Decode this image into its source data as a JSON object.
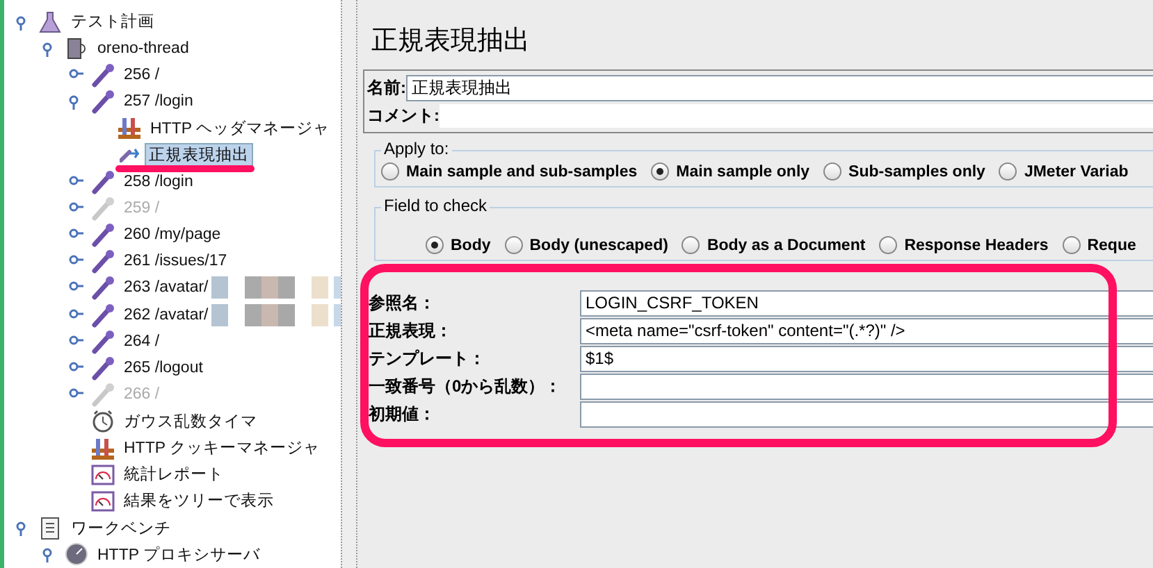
{
  "tree": [
    {
      "label": "テスト計画",
      "kind": "plan",
      "expanded": true,
      "children": [
        {
          "label": "oreno-thread",
          "kind": "thread",
          "expanded": true,
          "children": [
            {
              "label": "256 /",
              "kind": "sampler",
              "expanded": false,
              "disabled": false
            },
            {
              "label": "257 /login",
              "kind": "sampler",
              "expanded": true,
              "disabled": false,
              "children": [
                {
                  "label": "HTTP ヘッダマネージャ",
                  "kind": "manager",
                  "selected": false
                },
                {
                  "label": "正規表現抽出",
                  "kind": "extractor",
                  "selected": true
                }
              ]
            },
            {
              "label": "258 /login",
              "kind": "sampler",
              "expanded": false,
              "disabled": false
            },
            {
              "label": "259 /",
              "kind": "sampler",
              "expanded": false,
              "disabled": true
            },
            {
              "label": "260 /my/page",
              "kind": "sampler",
              "expanded": false,
              "disabled": false
            },
            {
              "label": "261 /issues/17",
              "kind": "sampler",
              "expanded": false,
              "disabled": false
            },
            {
              "label": "263 /avatar/",
              "kind": "sampler",
              "expanded": false,
              "disabled": false,
              "redacted": true
            },
            {
              "label": "262 /avatar/",
              "kind": "sampler",
              "expanded": false,
              "disabled": false,
              "redacted": true
            },
            {
              "label": "264 /",
              "kind": "sampler",
              "expanded": false,
              "disabled": false
            },
            {
              "label": "265 /logout",
              "kind": "sampler",
              "expanded": false,
              "disabled": false
            },
            {
              "label": "266 /",
              "kind": "sampler",
              "expanded": false,
              "disabled": true
            },
            {
              "label": "ガウス乱数タイマ",
              "kind": "timer"
            },
            {
              "label": "HTTP クッキーマネージャ",
              "kind": "manager"
            },
            {
              "label": "統計レポート",
              "kind": "report"
            },
            {
              "label": "結果をツリーで表示",
              "kind": "report"
            }
          ]
        }
      ]
    },
    {
      "label": "ワークベンチ",
      "kind": "workbench",
      "expanded": true,
      "children": [
        {
          "label": "HTTP プロキシサーバ",
          "kind": "proxy",
          "expanded": true
        }
      ]
    }
  ],
  "panel": {
    "title": "正規表現抽出",
    "name_label": "名前:",
    "name_value": "正規表現抽出",
    "comment_label": "コメント:",
    "apply_to": {
      "legend": "Apply to:",
      "options": [
        {
          "label": "Main sample and sub-samples",
          "selected": false
        },
        {
          "label": "Main sample only",
          "selected": true
        },
        {
          "label": "Sub-samples only",
          "selected": false
        },
        {
          "label": "JMeter Variab",
          "selected": false
        }
      ]
    },
    "field_to_check": {
      "legend": "Field to check",
      "options": [
        {
          "label": "Body",
          "selected": true
        },
        {
          "label": "Body (unescaped)",
          "selected": false
        },
        {
          "label": "Body as a Document",
          "selected": false
        },
        {
          "label": "Response Headers",
          "selected": false
        },
        {
          "label": "Reque",
          "selected": false
        }
      ]
    },
    "fields": [
      {
        "label": "参照名：",
        "value": "LOGIN_CSRF_TOKEN"
      },
      {
        "label": "正規表現：",
        "value": "<meta name=\"csrf-token\" content=\"(.*?)\" />"
      },
      {
        "label": "テンプレート：",
        "value": "$1$"
      },
      {
        "label": "一致番号（0から乱数）："
      },
      {
        "label": "初期値："
      }
    ]
  }
}
